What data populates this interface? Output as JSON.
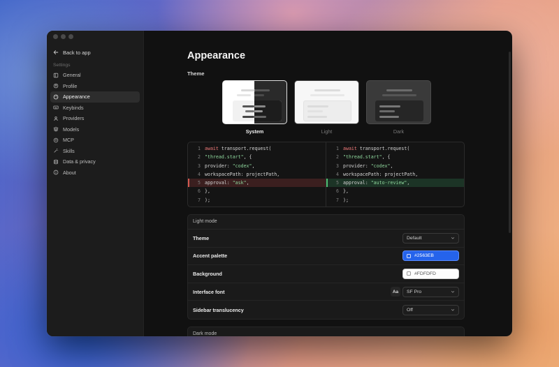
{
  "sidebar": {
    "back_label": "Back to app",
    "section_label": "Settings",
    "items": [
      {
        "label": "General",
        "icon": "panel-icon"
      },
      {
        "label": "Profile",
        "icon": "user-circle-icon"
      },
      {
        "label": "Appearance",
        "icon": "palette-icon",
        "active": true
      },
      {
        "label": "Keybinds",
        "icon": "keyboard-icon"
      },
      {
        "label": "Providers",
        "icon": "person-icon"
      },
      {
        "label": "Models",
        "icon": "layers-icon"
      },
      {
        "label": "MCP",
        "icon": "plug-icon"
      },
      {
        "label": "Skills",
        "icon": "wand-icon"
      },
      {
        "label": "Data & privacy",
        "icon": "database-icon"
      },
      {
        "label": "About",
        "icon": "info-icon"
      }
    ]
  },
  "page": {
    "title": "Appearance",
    "theme_section_label": "Theme",
    "themes": [
      {
        "name": "System",
        "selected": true
      },
      {
        "name": "Light",
        "selected": false
      },
      {
        "name": "Dark",
        "selected": false
      }
    ]
  },
  "diff": {
    "left": [
      {
        "n": "1",
        "parts": [
          [
            "kw",
            "await"
          ],
          [
            "plain",
            " transport.request("
          ]
        ]
      },
      {
        "n": "2",
        "parts": [
          [
            "str",
            "\"thread.start\""
          ],
          [
            "plain",
            ", {"
          ]
        ]
      },
      {
        "n": "3",
        "parts": [
          [
            "plain",
            "provider: "
          ],
          [
            "str",
            "\"codex\""
          ],
          [
            "plain",
            ","
          ]
        ]
      },
      {
        "n": "4",
        "parts": [
          [
            "plain",
            "workspacePath: projectPath,"
          ]
        ]
      },
      {
        "n": "5",
        "kind": "del",
        "parts": [
          [
            "plain",
            "approval: "
          ],
          [
            "str",
            "\"ask\""
          ],
          [
            "plain",
            ","
          ]
        ]
      },
      {
        "n": "6",
        "parts": [
          [
            "plain",
            "},"
          ]
        ]
      },
      {
        "n": "7",
        "parts": [
          [
            "plain",
            ");"
          ]
        ]
      }
    ],
    "right": [
      {
        "n": "1",
        "parts": [
          [
            "kw",
            "await"
          ],
          [
            "plain",
            " transport.request("
          ]
        ]
      },
      {
        "n": "2",
        "parts": [
          [
            "str",
            "\"thread.start\""
          ],
          [
            "plain",
            ", {"
          ]
        ]
      },
      {
        "n": "3",
        "parts": [
          [
            "plain",
            "provider: "
          ],
          [
            "str",
            "\"codex\""
          ],
          [
            "plain",
            ","
          ]
        ]
      },
      {
        "n": "4",
        "parts": [
          [
            "plain",
            "workspacePath: projectPath,"
          ]
        ]
      },
      {
        "n": "5",
        "kind": "add",
        "parts": [
          [
            "plain",
            "approval: "
          ],
          [
            "str",
            "\"auto-review\""
          ],
          [
            "plain",
            ","
          ]
        ]
      },
      {
        "n": "6",
        "parts": [
          [
            "plain",
            "},"
          ]
        ]
      },
      {
        "n": "7",
        "parts": [
          [
            "plain",
            ");"
          ]
        ]
      }
    ]
  },
  "light_mode": {
    "heading": "Light mode",
    "theme_label": "Theme",
    "theme_value": "Default",
    "accent_label": "Accent palette",
    "accent_value": "#2563EB",
    "background_label": "Background",
    "background_value": "#FDFDFD",
    "font_label": "Interface font",
    "font_aa": "Aa",
    "font_value": "SF Pro",
    "translucency_label": "Sidebar translucency",
    "translucency_value": "Off"
  },
  "dark_mode": {
    "heading": "Dark mode"
  },
  "colors": {
    "accent": "#2563EB",
    "background": "#FDFDFD"
  }
}
